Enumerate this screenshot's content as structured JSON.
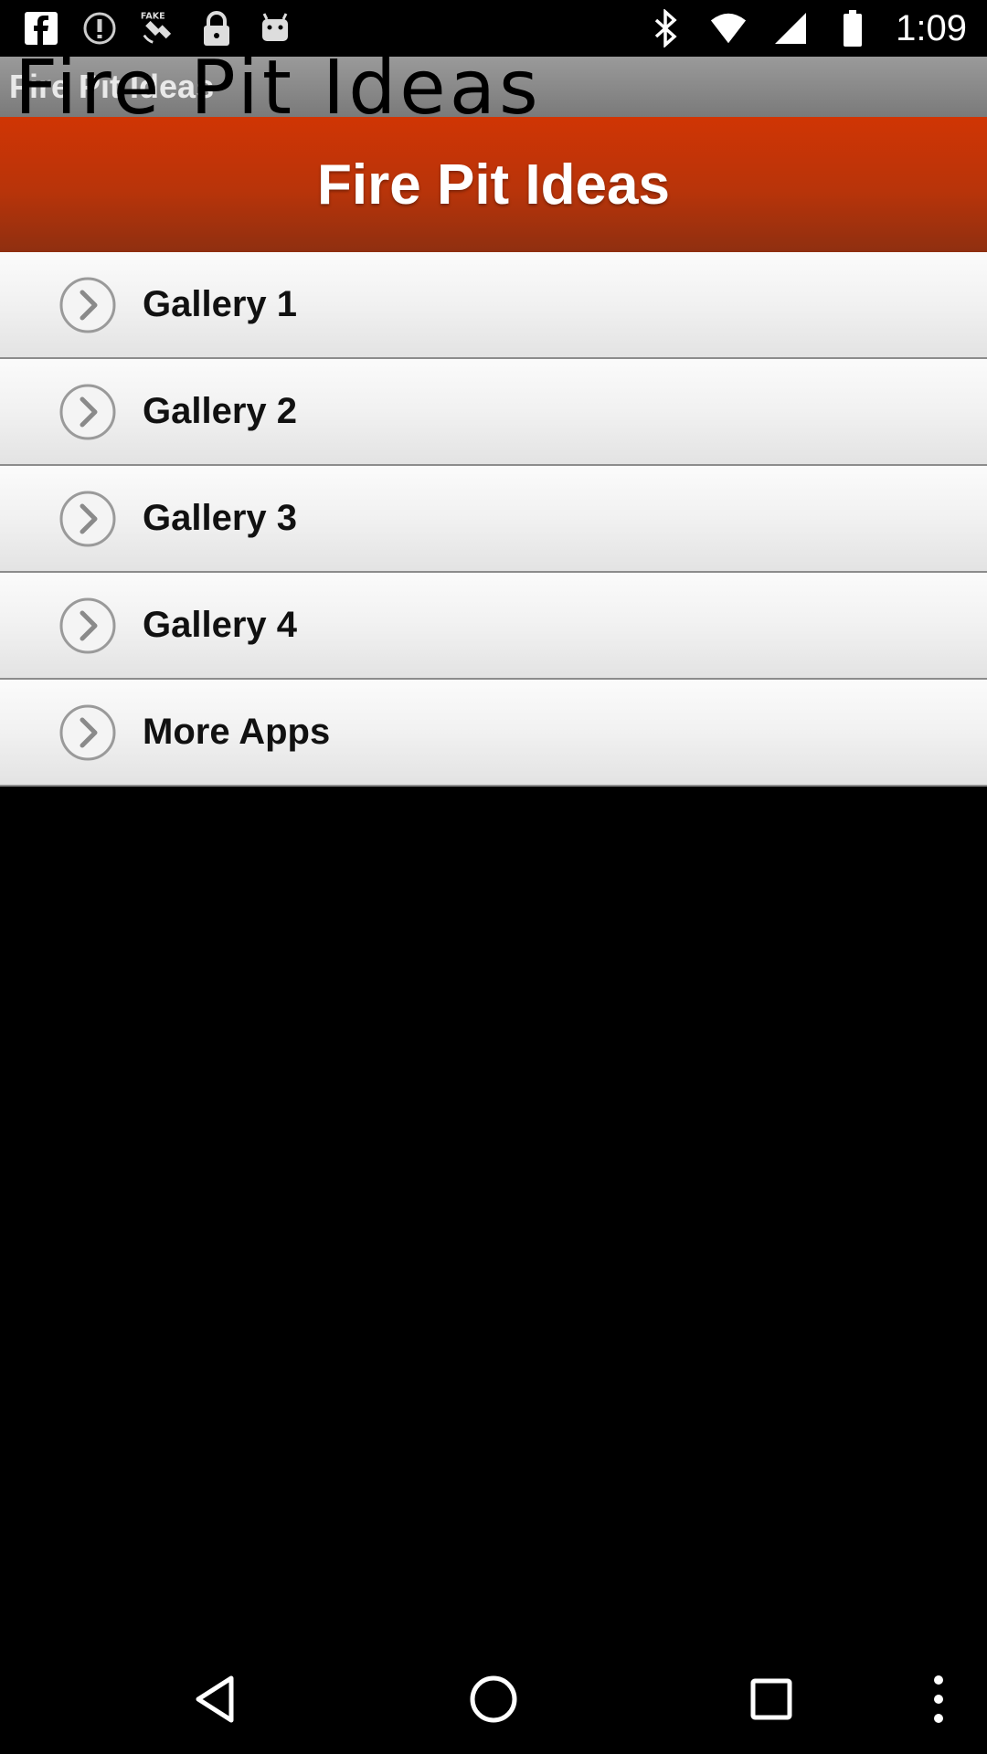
{
  "status_bar": {
    "time": "1:09",
    "left_icons": [
      "facebook-icon",
      "alert-icon",
      "fake-gps-icon",
      "lock-icon",
      "android-icon"
    ],
    "right_icons": [
      "bluetooth-icon",
      "wifi-icon",
      "signal-icon",
      "battery-icon"
    ]
  },
  "action_bar": {
    "title": "Fire Pit Ideas",
    "overlay_title": "Fire Pit Ideas"
  },
  "header": {
    "title": "Fire Pit Ideas"
  },
  "menu": {
    "items": [
      {
        "label": "Gallery 1"
      },
      {
        "label": "Gallery 2"
      },
      {
        "label": "Gallery 3"
      },
      {
        "label": "Gallery 4"
      },
      {
        "label": "More Apps"
      }
    ]
  },
  "nav_bar": {
    "buttons": [
      "back-icon",
      "home-icon",
      "recents-icon",
      "overflow-menu-icon"
    ]
  },
  "colors": {
    "header_top": "#d03504",
    "header_bottom": "#8f2f10",
    "action_bar": "#8a8a8a",
    "menu_bg": "#f1f1f1",
    "background": "#000000"
  }
}
